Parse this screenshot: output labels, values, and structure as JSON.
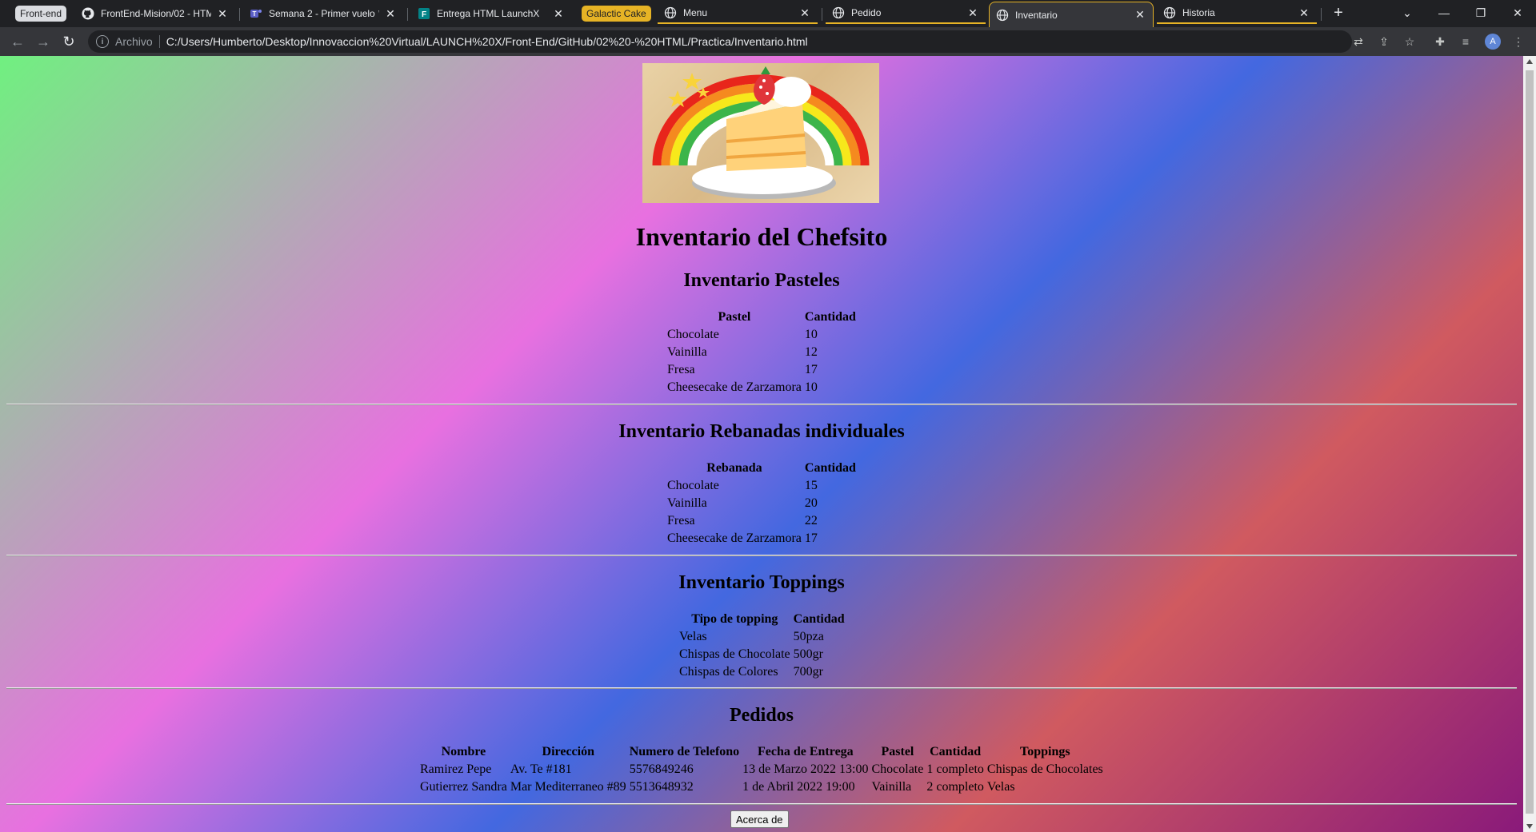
{
  "browser": {
    "tabs": [
      {
        "label": "FrontEnd-Mision/02 - HTM",
        "icon": "github-icon"
      },
      {
        "label": "Semana 2 - Primer vuelo 🛸",
        "icon": "teams-icon"
      },
      {
        "label": "Entrega HTML LaunchX",
        "icon": "forms-icon"
      },
      {
        "label": "Menu",
        "icon": "globe-icon"
      },
      {
        "label": "Pedido",
        "icon": "globe-icon"
      },
      {
        "label": "Inventario",
        "icon": "globe-icon"
      },
      {
        "label": "Historia",
        "icon": "globe-icon"
      }
    ],
    "groups": {
      "front_end": "Front-end",
      "galactic_cake": "Galactic Cake"
    },
    "address": {
      "scheme_label": "Archivo",
      "url": "C:/Users/Humberto/Desktop/Innovaccion%20Virtual/LAUNCH%20X/Front-End/GitHub/02%20-%20HTML/Practica/Inventario.html"
    },
    "profile_initial": "A",
    "group_color": "#e6b325"
  },
  "page": {
    "title": "Inventario del Chefsito",
    "pasteles": {
      "heading": "Inventario Pasteles",
      "headers": [
        "Pastel",
        "Cantidad"
      ],
      "rows": [
        [
          "Chocolate",
          "10"
        ],
        [
          "Vainilla",
          "12"
        ],
        [
          "Fresa",
          "17"
        ],
        [
          "Cheesecake de Zarzamora",
          "10"
        ]
      ]
    },
    "rebanadas": {
      "heading": "Inventario Rebanadas individuales",
      "headers": [
        "Rebanada",
        "Cantidad"
      ],
      "rows": [
        [
          "Chocolate",
          "15"
        ],
        [
          "Vainilla",
          "20"
        ],
        [
          "Fresa",
          "22"
        ],
        [
          "Cheesecake de Zarzamora",
          "17"
        ]
      ]
    },
    "toppings": {
      "heading": "Inventario Toppings",
      "headers": [
        "Tipo de topping",
        "Cantidad"
      ],
      "rows": [
        [
          "Velas",
          "50pza"
        ],
        [
          "Chispas de Chocolate",
          "500gr"
        ],
        [
          "Chispas de Colores",
          "700gr"
        ]
      ]
    },
    "pedidos": {
      "heading": "Pedidos",
      "headers": [
        "Nombre",
        "Dirección",
        "Numero de Telefono",
        "Fecha de Entrega",
        "Pastel",
        "Cantidad",
        "Toppings"
      ],
      "rows": [
        [
          "Ramirez Pepe",
          "Av. Te #181",
          "5576849246",
          "13 de Marzo 2022 13:00",
          "Chocolate",
          "1 completo",
          "Chispas de Chocolates"
        ],
        [
          "Gutierrez Sandra",
          "Mar Mediterraneo #89",
          "5513648932",
          "1 de Abril 2022 19:00",
          "Vainilla",
          "2 completo",
          "Velas"
        ]
      ]
    },
    "about_button": "Acerca de"
  }
}
